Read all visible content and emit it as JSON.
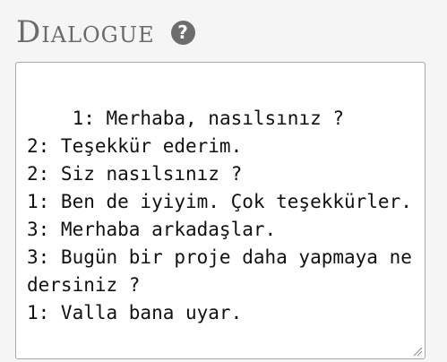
{
  "header": {
    "title": "Dialogue",
    "help_icon": "question-circle-icon",
    "help_glyph": "?"
  },
  "dialogue": {
    "text": "1: Merhaba, nasılsınız ?\n2: Teşekkür ederim.\n2: Siz nasılsınız ?\n1: Ben de iyiyim. Çok teşekkürler.\n3: Merhaba arkadaşlar.\n3: Bugün bir proje daha yapmaya ne dersiniz ?\n1: Valla bana uyar.",
    "resize_icon": "resize-grip-icon"
  },
  "colors": {
    "background": "#f5f5f5",
    "title": "#6b6b6b",
    "help_bg": "#6d6d6d",
    "border": "#a9a9a9",
    "text": "#111111"
  }
}
